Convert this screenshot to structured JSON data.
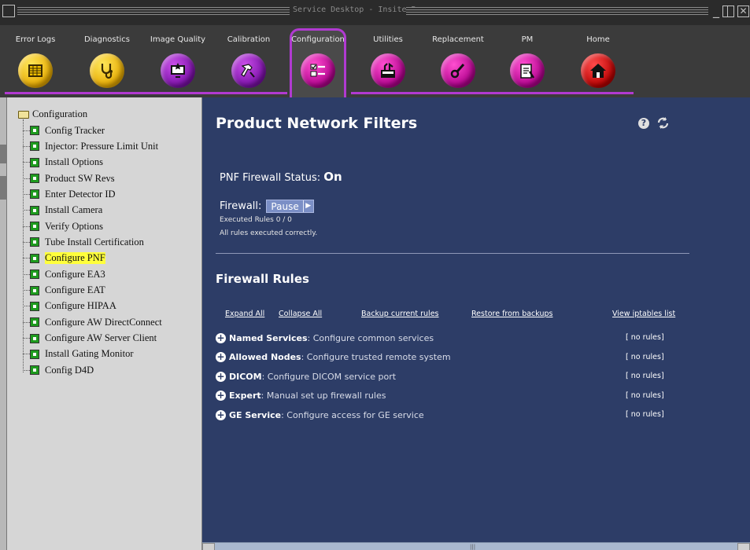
{
  "window": {
    "title": "Service Desktop - Insite_Browser"
  },
  "toolbar": {
    "items": [
      {
        "label": "Error Logs",
        "icon": "error-log-icon",
        "color": "#e6a900"
      },
      {
        "label": "Diagnostics",
        "icon": "stethoscope-icon",
        "color": "#e6a900"
      },
      {
        "label": "Image Quality",
        "icon": "monitor-icon",
        "color": "#7b10a8"
      },
      {
        "label": "Calibration",
        "icon": "tools-icon",
        "color": "#7b10a8"
      },
      {
        "label": "Configuration",
        "icon": "checklist-icon",
        "color": "#b0008c",
        "active": true
      },
      {
        "label": "Utilities",
        "icon": "toolbox-icon",
        "color": "#b0008c"
      },
      {
        "label": "Replacement",
        "icon": "wrench-icon",
        "color": "#b0008c"
      },
      {
        "label": "PM",
        "icon": "clipboard-icon",
        "color": "#b0008c"
      },
      {
        "label": "Home",
        "icon": "home-icon",
        "color": "#b80000"
      }
    ]
  },
  "tree": {
    "root": "Configuration",
    "items": [
      "Config Tracker",
      "Injector: Pressure Limit Unit",
      "Install Options",
      "Product SW Revs",
      "Enter Detector ID",
      "Install Camera",
      "Verify Options",
      "Tube Install Certification",
      "Configure PNF",
      "Configure EA3",
      "Configure EAT",
      "Configure HIPAA",
      "Configure AW DirectConnect",
      "Configure AW Server Client",
      "Install Gating Monitor",
      "Config D4D"
    ],
    "selected": "Configure PNF"
  },
  "main": {
    "title": "Product Network Filters",
    "status_label": "PNF Firewall Status:",
    "status_value": "On",
    "firewall_label": "Firewall:",
    "pause_label": "Pause",
    "executed": "Executed Rules 0 / 0",
    "executed_note": "All rules executed correctly.",
    "rules_title": "Firewall Rules",
    "links": {
      "expand": "Expand All",
      "collapse": "Collapse All",
      "backup": "Backup current rules",
      "restore": "Restore from backups",
      "iptables": "View iptables list"
    },
    "rules": [
      {
        "name": "Named Services",
        "desc": ": Configure common services",
        "status": "[ no rules]"
      },
      {
        "name": "Allowed Nodes",
        "desc": ": Configure trusted remote system",
        "status": "[ no rules]"
      },
      {
        "name": "DICOM",
        "desc": ": Configure DICOM service port",
        "status": "[ no rules]"
      },
      {
        "name": "Expert",
        "desc": ": Manual set up firewall rules",
        "status": "[ no rules]"
      },
      {
        "name": "GE Service",
        "desc": ": Configure access for GE service",
        "status": "[ no rules]"
      }
    ]
  },
  "colors": {
    "accent": "#b13ad1",
    "main_bg": "#2d3d67",
    "selected_highlight": "#ffff3c"
  }
}
